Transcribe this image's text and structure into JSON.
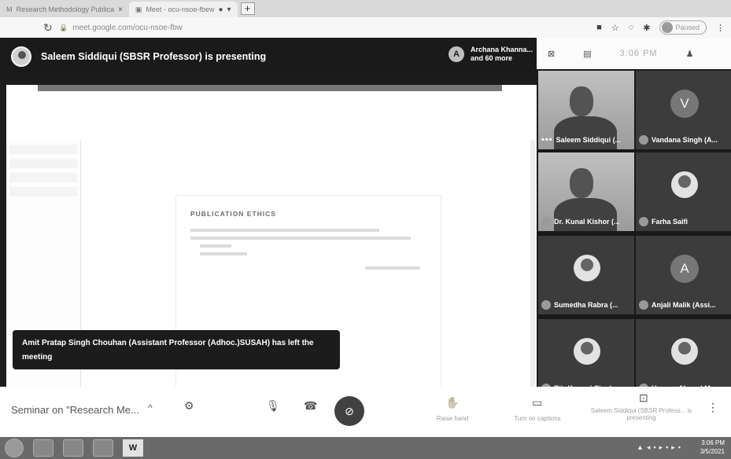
{
  "browser": {
    "tabs": [
      {
        "label": "Research Methodology Publica",
        "active": false
      },
      {
        "label": "Meet - ocu-nsoe-fbew",
        "active": true
      }
    ],
    "url": "meet.google.com/ocu-nsoe-fbw",
    "profile_label": "Paused"
  },
  "meet": {
    "presenter_text": "Saleem Siddiqui (SBSR Professor) is presenting",
    "others": {
      "avatar_letter": "A",
      "line1": "Archana Khanna...",
      "line2": "and 60 more"
    },
    "time": "3:06 PM",
    "notification": "Amit Pratap Singh Chouhan (Assistant Professor (Adhoc.)SUSAH) has left the meeting",
    "slide_title": "PUBLICATION ETHICS",
    "tiles": [
      {
        "name": "Saleem Siddiqui (...",
        "kind": "camera",
        "more_dots": "•••"
      },
      {
        "name": "Vandana Singh (A...",
        "kind": "letter",
        "letter": "V"
      },
      {
        "name": "Dr. Kunal Kishor (...",
        "kind": "camera"
      },
      {
        "name": "Farha Saifi",
        "kind": "photo"
      },
      {
        "name": "Sumedha Rabra (...",
        "kind": "photo"
      },
      {
        "name": "Anjali Malik (Assi...",
        "kind": "letter",
        "letter": "A"
      },
      {
        "name": "RituKumari Singh",
        "kind": "photo"
      },
      {
        "name": "Hassan Ahmed M...",
        "kind": "photo"
      }
    ]
  },
  "controls": {
    "meeting_name": "Seminar on \"Research Me...",
    "raise_hand_label": "Raise hand",
    "captions_label": "Turn on captions",
    "presenting_label": "Saleem Siddiqui (SBSR Profess... is presenting"
  },
  "taskbar": {
    "word_label": "W",
    "clock_time": "3:06 PM",
    "clock_date": "3/5/2021"
  }
}
